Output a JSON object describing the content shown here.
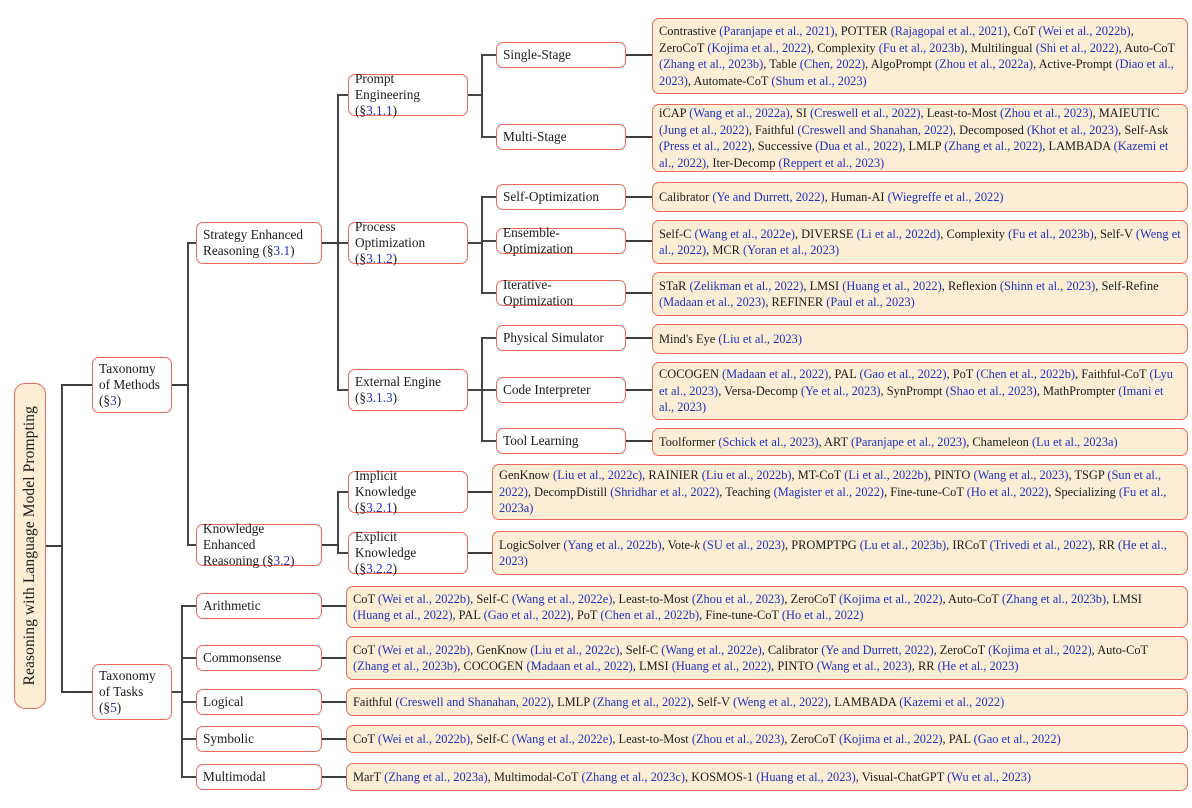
{
  "diagram": {
    "title": "Reasoning with Language Model Prompting",
    "type": "taxonomy-tree",
    "colors": {
      "node_border": "#e8685e",
      "leaf_fill": "#fbeed5",
      "node_fill": "#ffffff",
      "citation_text": "#2030c0",
      "edge": "#3d3d3d",
      "body_text": "#1a1a1a"
    }
  },
  "root": {
    "label": "Reasoning with Language Model Prompting"
  },
  "level1": [
    {
      "id": "taxonomy-methods",
      "label": "Taxonomy\nof Methods\n(§3)",
      "lines": [
        "Taxonomy",
        "of Methods",
        "(§3)"
      ],
      "section": "3"
    },
    {
      "id": "taxonomy-tasks",
      "label": "Taxonomy\nof Tasks\n(§5)",
      "lines": [
        "Taxonomy",
        "of Tasks",
        "(§5)"
      ],
      "section": "5"
    }
  ],
  "level2": [
    {
      "id": "strategy-enhanced-reasoning",
      "lines": [
        "Strategy Enhanced",
        "Reasoning (§3.1)"
      ],
      "section": "3.1"
    },
    {
      "id": "knowledge-enhanced-reasoning",
      "lines": [
        "Knowledge Enhanced",
        "Reasoning (§3.2)"
      ],
      "section": "3.2"
    }
  ],
  "level3": [
    {
      "id": "prompt-engineering",
      "lines": [
        "Prompt Engineering",
        "(§3.1.1)"
      ],
      "section": "3.1.1"
    },
    {
      "id": "process-optimization",
      "lines": [
        "Process Optimization",
        "(§3.1.2)"
      ],
      "section": "3.1.2"
    },
    {
      "id": "external-engine",
      "lines": [
        "External Engine",
        "(§3.1.3)"
      ],
      "section": "3.1.3"
    },
    {
      "id": "implicit-knowledge",
      "lines": [
        "Implicit Knowledge",
        "(§3.2.1)"
      ],
      "section": "3.2.1"
    },
    {
      "id": "explicit-knowledge",
      "lines": [
        "Explicit Knowledge",
        "(§3.2.2)"
      ],
      "section": "3.2.2"
    }
  ],
  "level4": [
    {
      "id": "single-stage",
      "label": "Single-Stage"
    },
    {
      "id": "multi-stage",
      "label": "Multi-Stage"
    },
    {
      "id": "self-optimization",
      "label": "Self-Optimization"
    },
    {
      "id": "ensemble-optimization",
      "label": "Ensemble-Optimization"
    },
    {
      "id": "iterative-optimization",
      "label": "Iterative-Optimization"
    },
    {
      "id": "physical-simulator",
      "label": "Physical Simulator"
    },
    {
      "id": "code-interpreter",
      "label": "Code Interpreter"
    },
    {
      "id": "tool-learning",
      "label": "Tool Learning"
    }
  ],
  "tasks": [
    {
      "id": "arithmetic",
      "label": "Arithmetic"
    },
    {
      "id": "commonsense",
      "label": "Commonsense"
    },
    {
      "id": "logical",
      "label": "Logical"
    },
    {
      "id": "symbolic",
      "label": "Symbolic"
    },
    {
      "id": "multimodal",
      "label": "Multimodal"
    }
  ],
  "leaves": {
    "single-stage": {
      "methods": [
        {
          "name": "Contrastive",
          "cite": "(Paranjape et al., 2021)"
        },
        {
          "name": "POTTER",
          "cite": "(Rajagopal et al., 2021)"
        },
        {
          "name": "CoT",
          "cite": "(Wei et al., 2022b)"
        },
        {
          "name": "ZeroCoT",
          "cite": "(Kojima et al., 2022)"
        },
        {
          "name": "Complexity",
          "cite": "(Fu et al., 2023b)"
        },
        {
          "name": "Multilingual",
          "cite": "(Shi et al., 2022)"
        },
        {
          "name": "Auto-CoT",
          "cite": "(Zhang et al., 2023b)"
        },
        {
          "name": "Table",
          "cite": "(Chen, 2022)"
        },
        {
          "name": "AlgoPrompt",
          "cite": "(Zhou et al., 2022a)"
        },
        {
          "name": "Active-Prompt",
          "cite": "(Diao et al., 2023)"
        },
        {
          "name": "Automate-CoT",
          "cite": "(Shum et al., 2023)"
        }
      ]
    },
    "multi-stage": {
      "methods": [
        {
          "name": "iCAP",
          "cite": "(Wang et al., 2022a)"
        },
        {
          "name": "SI",
          "cite": "(Creswell et al., 2022)"
        },
        {
          "name": "Least-to-Most",
          "cite": "(Zhou et al., 2023)"
        },
        {
          "name": "MAIEUTIC",
          "cite": "(Jung et al., 2022)"
        },
        {
          "name": "Faithful",
          "cite": "(Creswell and Shanahan, 2022)"
        },
        {
          "name": "Decomposed",
          "cite": "(Khot et al., 2023)"
        },
        {
          "name": "Self-Ask",
          "cite": "(Press et al., 2022)"
        },
        {
          "name": "Successive",
          "cite": "(Dua et al., 2022)"
        },
        {
          "name": "LMLP",
          "cite": "(Zhang et al., 2022)"
        },
        {
          "name": "LAMBADA",
          "cite": "(Kazemi et al., 2022)"
        },
        {
          "name": "Iter-Decomp",
          "cite": "(Reppert et al., 2023)"
        }
      ]
    },
    "self-optimization": {
      "methods": [
        {
          "name": "Calibrator",
          "cite": "(Ye and Durrett, 2022)"
        },
        {
          "name": "Human-AI",
          "cite": "(Wiegreffe et al., 2022)"
        }
      ]
    },
    "ensemble-optimization": {
      "methods": [
        {
          "name": "Self-C",
          "cite": "(Wang et al., 2022e)"
        },
        {
          "name": "DIVERSE",
          "cite": "(Li et al., 2022d)"
        },
        {
          "name": "Complexity",
          "cite": "(Fu et al., 2023b)"
        },
        {
          "name": "Self-V",
          "cite": "(Weng et al., 2022)"
        },
        {
          "name": "MCR",
          "cite": "(Yoran et al., 2023)"
        }
      ]
    },
    "iterative-optimization": {
      "methods": [
        {
          "name": "STaR",
          "cite": "(Zelikman et al., 2022)"
        },
        {
          "name": "LMSI",
          "cite": "(Huang et al., 2022)"
        },
        {
          "name": "Reflexion",
          "cite": "(Shinn et al., 2023)"
        },
        {
          "name": "Self-Refine",
          "cite": "(Madaan et al., 2023)"
        },
        {
          "name": "REFINER",
          "cite": "(Paul et al., 2023)"
        }
      ]
    },
    "physical-simulator": {
      "methods": [
        {
          "name": "Mind's Eye",
          "cite": "(Liu et al., 2023)"
        }
      ]
    },
    "code-interpreter": {
      "methods": [
        {
          "name": "COCOGEN",
          "cite": "(Madaan et al., 2022)"
        },
        {
          "name": "PAL",
          "cite": "(Gao et al., 2022)"
        },
        {
          "name": "PoT",
          "cite": "(Chen et al., 2022b)"
        },
        {
          "name": "Faithful-CoT",
          "cite": "(Lyu et al., 2023)"
        },
        {
          "name": "Versa-Decomp",
          "cite": "(Ye et al., 2023)"
        },
        {
          "name": "SynPrompt",
          "cite": "(Shao et al., 2023)"
        },
        {
          "name": "MathPrompter",
          "cite": "(Imani et al., 2023)"
        }
      ]
    },
    "tool-learning": {
      "methods": [
        {
          "name": "Toolformer",
          "cite": "(Schick et al., 2023)"
        },
        {
          "name": "ART",
          "cite": "(Paranjape et al., 2023)"
        },
        {
          "name": "Chameleon",
          "cite": "(Lu et al., 2023a)"
        }
      ]
    },
    "implicit-knowledge": {
      "methods": [
        {
          "name": "GenKnow",
          "cite": "(Liu et al., 2022c)"
        },
        {
          "name": "RAINIER",
          "cite": "(Liu et al., 2022b)"
        },
        {
          "name": "MT-CoT",
          "cite": "(Li et al., 2022b)"
        },
        {
          "name": "PINTO",
          "cite": "(Wang et al., 2023)"
        },
        {
          "name": "TSGP",
          "cite": "(Sun et al., 2022)"
        },
        {
          "name": "DecompDistill",
          "cite": "(Shridhar et al., 2022)"
        },
        {
          "name": "Teaching",
          "cite": "(Magister et al., 2022)"
        },
        {
          "name": "Fine-tune-CoT",
          "cite": "(Ho et al., 2022)"
        },
        {
          "name": "Specializing",
          "cite": "(Fu et al., 2023a)"
        }
      ]
    },
    "explicit-knowledge": {
      "methods": [
        {
          "name": "LogicSolver",
          "cite": "(Yang et al., 2022b)"
        },
        {
          "name": "Vote-k",
          "cite": "(SU et al., 2023)",
          "italic_suffix": "k"
        },
        {
          "name": "PROMPTPG",
          "cite": "(Lu et al., 2023b)"
        },
        {
          "name": "IRCoT",
          "cite": "(Trivedi et al., 2022)"
        },
        {
          "name": "RR",
          "cite": "(He et al., 2023)"
        }
      ]
    },
    "arithmetic": {
      "methods": [
        {
          "name": "CoT",
          "cite": "(Wei et al., 2022b)"
        },
        {
          "name": "Self-C",
          "cite": "(Wang et al., 2022e)"
        },
        {
          "name": "Least-to-Most",
          "cite": "(Zhou et al., 2023)"
        },
        {
          "name": "ZeroCoT",
          "cite": "(Kojima et al., 2022)"
        },
        {
          "name": "Auto-CoT",
          "cite": "(Zhang et al., 2023b)"
        },
        {
          "name": "LMSI",
          "cite": "(Huang et al., 2022)"
        },
        {
          "name": "PAL",
          "cite": "(Gao et al., 2022)"
        },
        {
          "name": "PoT",
          "cite": "(Chen et al., 2022b)"
        },
        {
          "name": "Fine-tune-CoT",
          "cite": "(Ho et al., 2022)"
        }
      ]
    },
    "commonsense": {
      "methods": [
        {
          "name": "CoT",
          "cite": "(Wei et al., 2022b)"
        },
        {
          "name": "GenKnow",
          "cite": "(Liu et al., 2022c)"
        },
        {
          "name": "Self-C",
          "cite": "(Wang et al., 2022e)"
        },
        {
          "name": "Calibrator",
          "cite": "(Ye and Durrett, 2022)"
        },
        {
          "name": "ZeroCoT",
          "cite": "(Kojima et al., 2022)"
        },
        {
          "name": "Auto-CoT",
          "cite": "(Zhang et al., 2023b)"
        },
        {
          "name": "COCOGEN",
          "cite": "(Madaan et al., 2022)"
        },
        {
          "name": "LMSI",
          "cite": "(Huang et al., 2022)"
        },
        {
          "name": "PINTO",
          "cite": "(Wang et al., 2023)"
        },
        {
          "name": "RR",
          "cite": "(He et al., 2023)"
        }
      ]
    },
    "logical": {
      "methods": [
        {
          "name": "Faithful",
          "cite": "(Creswell and Shanahan, 2022)"
        },
        {
          "name": "LMLP",
          "cite": "(Zhang et al., 2022)"
        },
        {
          "name": "Self-V",
          "cite": "(Weng et al., 2022)"
        },
        {
          "name": "LAMBADA",
          "cite": "(Kazemi et al., 2022)"
        }
      ]
    },
    "symbolic": {
      "methods": [
        {
          "name": "CoT",
          "cite": "(Wei et al., 2022b)"
        },
        {
          "name": "Self-C",
          "cite": "(Wang et al., 2022e)"
        },
        {
          "name": "Least-to-Most",
          "cite": "(Zhou et al., 2023)"
        },
        {
          "name": "ZeroCoT",
          "cite": "(Kojima et al., 2022)"
        },
        {
          "name": "PAL",
          "cite": "(Gao et al., 2022)"
        }
      ]
    },
    "multimodal": {
      "methods": [
        {
          "name": "MarT",
          "cite": "(Zhang et al., 2023a)"
        },
        {
          "name": "Multimodal-CoT",
          "cite": "(Zhang et al., 2023c)"
        },
        {
          "name": "KOSMOS-1",
          "cite": "(Huang et al., 2023)"
        },
        {
          "name": "Visual-ChatGPT",
          "cite": "(Wu et al., 2023)"
        }
      ]
    }
  }
}
